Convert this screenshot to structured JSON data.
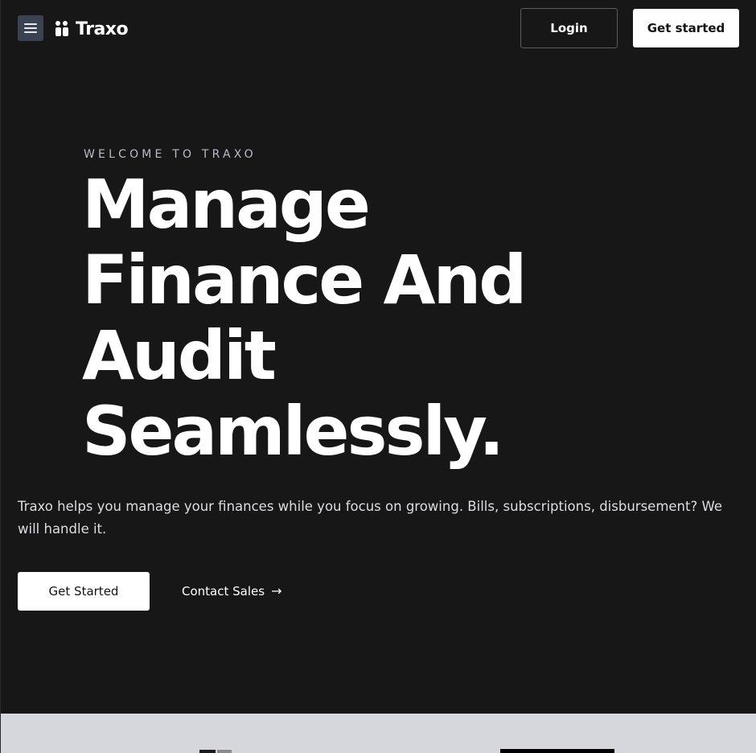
{
  "header": {
    "brand_name": "Traxo",
    "menu_icon": "hamburger-menu-icon",
    "logo_icon": "traxo-logo-icon",
    "login_label": "Login",
    "get_started_label": "Get started"
  },
  "hero": {
    "eyebrow": "WELCOME TO TRAXO",
    "headline_lines": [
      "Manage",
      "Finance And",
      "Audit",
      "Seamlessly."
    ],
    "subcopy": "Traxo helps you manage your finances while you focus on growing. Bills, subscriptions, disbursement? We will handle it.",
    "primary_cta": "Get Started",
    "secondary_cta": "Contact Sales",
    "secondary_cta_icon": "arrow-right-icon"
  },
  "colors": {
    "background": "#171717",
    "menu_button_bg": "#3b4352",
    "button_light": "#ffffff",
    "lower_section_bg": "#d5d7dd"
  }
}
